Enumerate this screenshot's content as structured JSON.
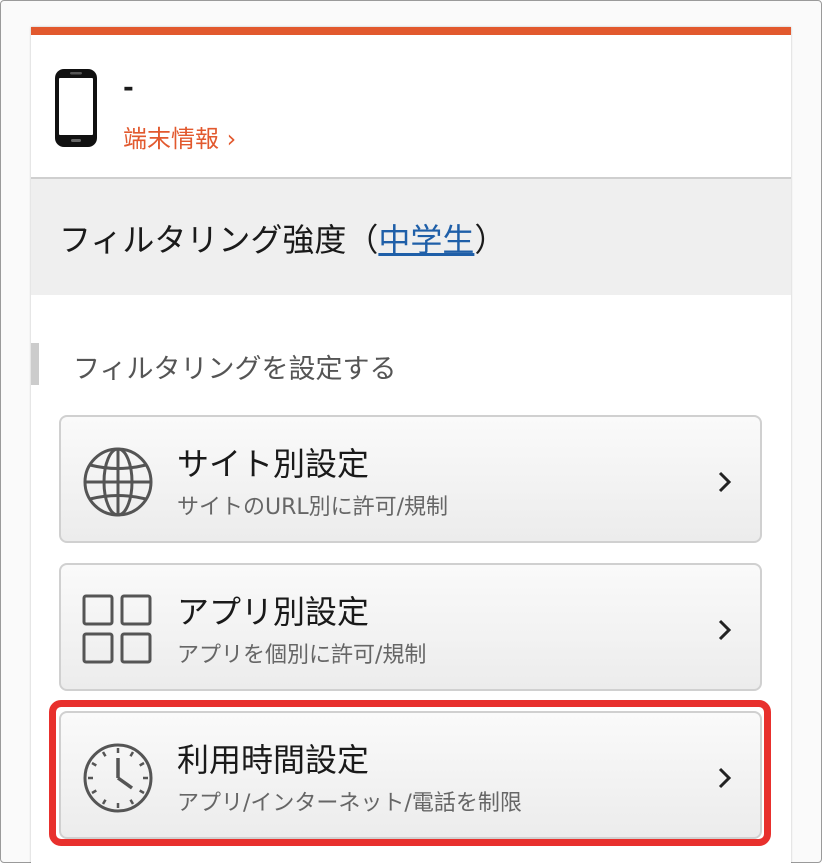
{
  "colors": {
    "accent": "#e2592e",
    "link_blue": "#1f5fa8",
    "highlight_red": "#e8302d",
    "icon_gray": "#555555"
  },
  "device": {
    "icon": "smartphone-icon",
    "name": "-",
    "info_link": "端末情報 ›"
  },
  "filter_strength": {
    "prefix": "フィルタリング強度（",
    "level": "中学生",
    "suffix": "）"
  },
  "section": {
    "title": "フィルタリングを設定する"
  },
  "menu": [
    {
      "icon": "globe-icon",
      "title": "サイト別設定",
      "subtitle": "サイトのURL別に許可/規制"
    },
    {
      "icon": "app-grid-icon",
      "title": "アプリ別設定",
      "subtitle": "アプリを個別に許可/規制"
    },
    {
      "icon": "clock-icon",
      "title": "利用時間設定",
      "subtitle": "アプリ/インターネット/電話を制限"
    }
  ]
}
